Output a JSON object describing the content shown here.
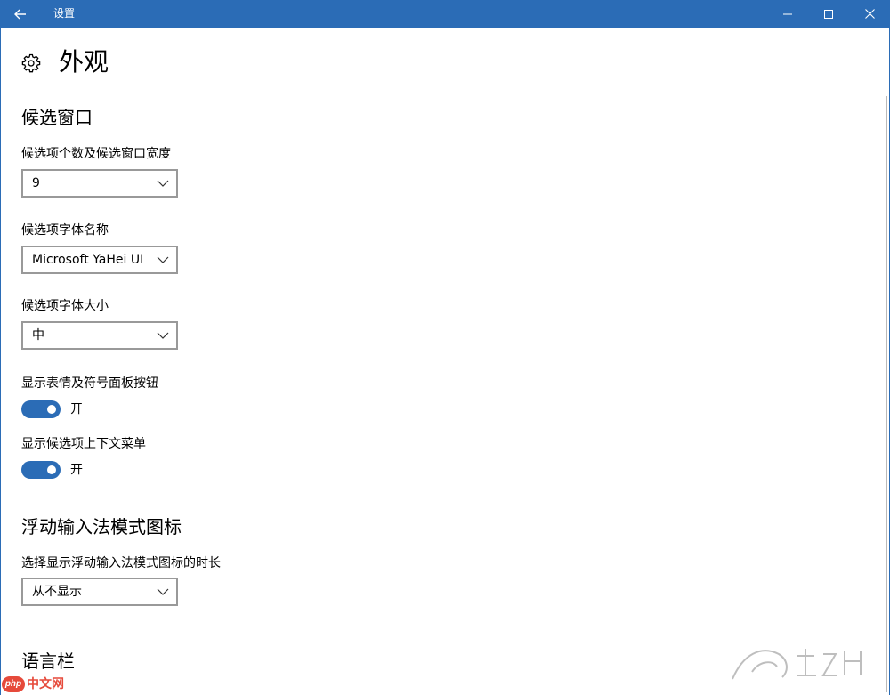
{
  "window": {
    "title": "设置",
    "accent": "#2b6cb6"
  },
  "titlebar": {
    "back_icon": "arrow-left-icon",
    "min_icon": "minimize-icon",
    "max_icon": "maximize-icon",
    "close_icon": "close-icon"
  },
  "page": {
    "icon": "gear-icon",
    "title": "外观"
  },
  "candidate_window": {
    "section_title": "候选窗口",
    "count_label": "候选项个数及候选窗口宽度",
    "count_value": "9",
    "font_name_label": "候选项字体名称",
    "font_name_value": "Microsoft YaHei UI",
    "font_size_label": "候选项字体大小",
    "font_size_value": "中",
    "emoji_button_label": "显示表情及符号面板按钮",
    "emoji_button_state": "开",
    "context_menu_label": "显示候选项上下文菜单",
    "context_menu_state": "开"
  },
  "floating_ime": {
    "section_title": "浮动输入法模式图标",
    "duration_label": "选择显示浮动输入法模式图标的时长",
    "duration_value": "从不显示"
  },
  "language_bar": {
    "section_title": "语言栏"
  },
  "watermark": {
    "php_badge": "php",
    "cn_text": "中文网"
  }
}
